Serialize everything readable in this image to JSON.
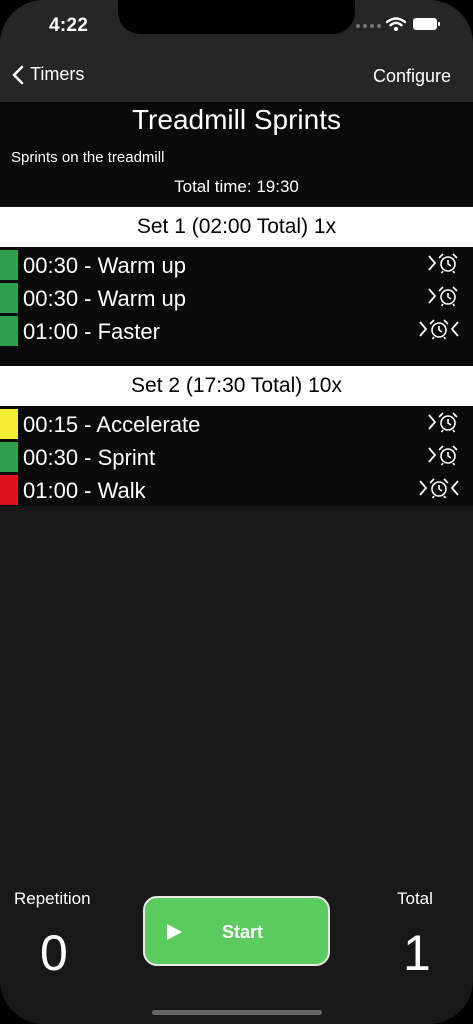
{
  "status_bar": {
    "time": "4:22"
  },
  "nav": {
    "back_label": "Timers",
    "configure_label": "Configure"
  },
  "workout": {
    "title": "Treadmill Sprints",
    "description": "Sprints on the treadmill",
    "total_time": "Total time: 19:30"
  },
  "sets": [
    {
      "header": "Set 1 (02:00 Total) 1x",
      "items": [
        {
          "label": "00:30 - Warm up",
          "color": "#2e9e4f",
          "icons": [
            "chevron-right-icon",
            "alarm-clock-icon"
          ]
        },
        {
          "label": "00:30 - Warm up",
          "color": "#2e9e4f",
          "icons": [
            "chevron-right-icon",
            "alarm-clock-icon"
          ]
        },
        {
          "label": "01:00 - Faster",
          "color": "#2e9e4f",
          "icons": [
            "chevron-right-icon",
            "alarm-clock-icon",
            "chevron-left-icon"
          ]
        }
      ]
    },
    {
      "header": "Set 2 (17:30 Total) 10x",
      "items": [
        {
          "label": "00:15 - Accelerate",
          "color": "#f5ee33",
          "icons": [
            "chevron-right-icon",
            "alarm-clock-icon"
          ]
        },
        {
          "label": "00:30 - Sprint",
          "color": "#2e9e4f",
          "icons": [
            "chevron-right-icon",
            "alarm-clock-icon"
          ]
        },
        {
          "label": "01:00 - Walk",
          "color": "#e0111b",
          "icons": [
            "chevron-right-icon",
            "alarm-clock-icon",
            "chevron-left-icon"
          ]
        }
      ]
    }
  ],
  "footer": {
    "repetition_label": "Repetition",
    "repetition_value": "0",
    "start_label": "Start",
    "total_label": "Total",
    "total_value": "1"
  },
  "colors": {
    "start_button": "#5ccb5f",
    "background": "#181818"
  }
}
